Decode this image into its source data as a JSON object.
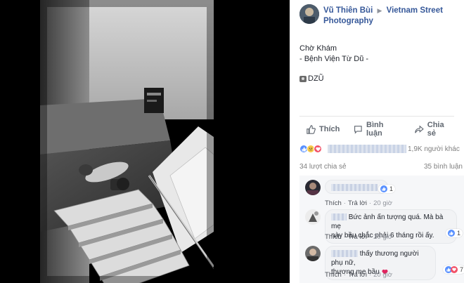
{
  "post": {
    "author": "Vũ Thiên Bùi",
    "group": "Vietnam Street Photography",
    "text_lines": [
      "Chờ Khám",
      "- Bệnh Viện Từ Dũ -"
    ],
    "signature": "DZŨ"
  },
  "actions": {
    "like_label": "Thích",
    "comment_label": "Bình luận",
    "share_label": "Chia sẻ"
  },
  "reactions": {
    "summary_suffix": "1,9K người khác"
  },
  "stats": {
    "shares": "34 lượt chia sẻ",
    "comments": "35 bình luận"
  },
  "comments": [
    {
      "text": "",
      "like_count": "1",
      "like_label": "Thích",
      "reply_label": "Trả lời",
      "time": "20 giờ"
    },
    {
      "text_line1": "Bức ảnh ấn tượng quá. Mà bà mẹ",
      "text_line2": "này bầu chắc phải 6 tháng rồi ấy.",
      "like_count": "1",
      "like_label": "Thích",
      "reply_label": "Trả lời",
      "time": "20 giờ"
    },
    {
      "text_line1": "thấy thương người phụ nữ,",
      "text_line2": "thương mẹ bầu",
      "like_count": "7",
      "like_label": "Thích",
      "reply_label": "Trả lời",
      "time": "20 giờ"
    }
  ],
  "colors": {
    "link": "#365899",
    "accent_like": "#5890ff",
    "heart": "#e0245e",
    "muted": "#90949c"
  }
}
